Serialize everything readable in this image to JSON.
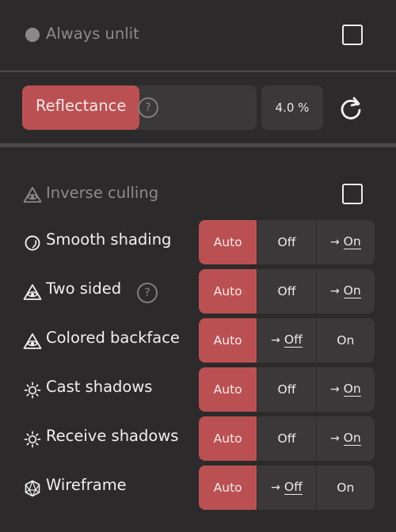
{
  "always_unlit": {
    "label": "Always unlit",
    "checked": false
  },
  "reflectance": {
    "label": "Reflectance",
    "help": "?",
    "value": "4.0 %",
    "fill_fraction": 0.04,
    "fill_color": "#bb5052"
  },
  "inverse_culling": {
    "label": "Inverse culling",
    "checked": false
  },
  "help_glyph": "?",
  "arrow": "→",
  "rows": [
    {
      "label": "Smooth shading",
      "icon": "smooth-shading-icon",
      "options": [
        "Auto",
        "Off",
        "On"
      ],
      "active": "Auto",
      "indicated": "On"
    },
    {
      "label": "Two sided",
      "icon": "eye-triangle-icon",
      "options": [
        "Auto",
        "Off",
        "On"
      ],
      "active": "Auto",
      "indicated": "On"
    },
    {
      "label": "Colored backface",
      "icon": "eye-triangle-icon",
      "options": [
        "Auto",
        "Off",
        "On"
      ],
      "active": "Auto",
      "indicated": "Off"
    },
    {
      "label": "Cast shadows",
      "icon": "sun-icon",
      "options": [
        "Auto",
        "Off",
        "On"
      ],
      "active": "Auto",
      "indicated": "On"
    },
    {
      "label": "Receive shadows",
      "icon": "sun-icon",
      "options": [
        "Auto",
        "Off",
        "On"
      ],
      "active": "Auto",
      "indicated": "On"
    },
    {
      "label": "Wireframe",
      "icon": "wireframe-icon",
      "options": [
        "Auto",
        "Off",
        "On"
      ],
      "active": "Auto",
      "indicated": "Off"
    }
  ],
  "colors": {
    "background": "#2c2a2b",
    "accent": "#bb5052",
    "control": "#3a3839",
    "muted_text": "#8c8a8b"
  }
}
